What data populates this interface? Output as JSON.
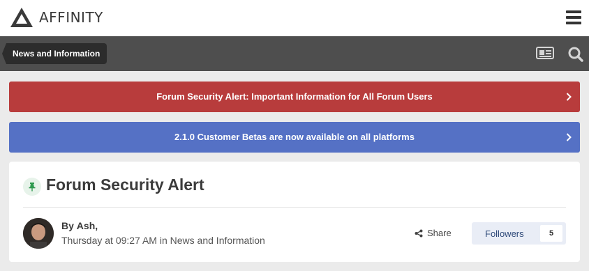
{
  "header": {
    "brand": "AFFINITY",
    "logo_icon": "affinity-logo-icon",
    "menu_icon": "hamburger-menu-icon"
  },
  "nav": {
    "breadcrumb": "News and Information",
    "icons": [
      "newspaper-icon",
      "search-icon"
    ]
  },
  "banners": [
    {
      "text": "Forum Security Alert: Important Information for All Forum Users",
      "color": "#b83c3c"
    },
    {
      "text": "2.1.0 Customer Betas are now available on all platforms",
      "color": "#5571c5"
    }
  ],
  "topic": {
    "title": "Forum Security Alert",
    "pin_icon": "pin-icon",
    "author_prefix": "By",
    "author": "Ash,",
    "date": "Thursday at 09:27 AM",
    "in_word": "in",
    "forum": "News and Information",
    "share_label": "Share",
    "followers_label": "Followers",
    "followers_count": "5"
  }
}
